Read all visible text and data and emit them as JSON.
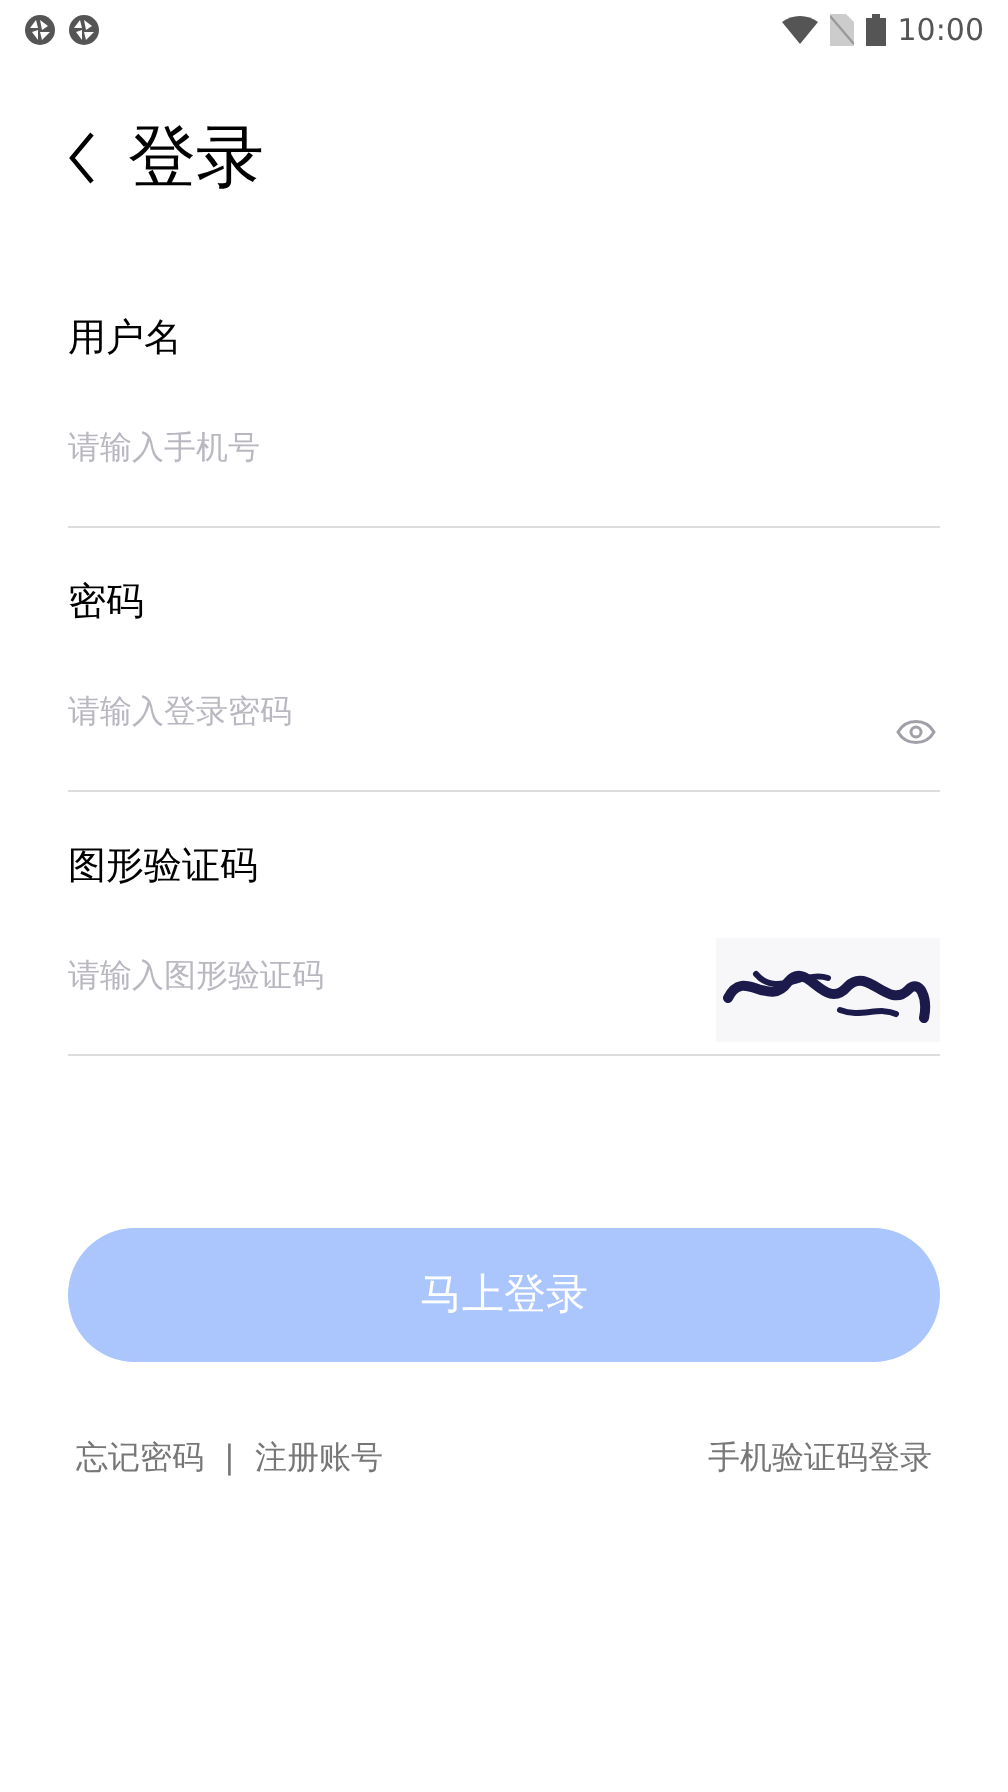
{
  "status_bar": {
    "time": "10:00"
  },
  "header": {
    "title": "登录"
  },
  "fields": [
    {
      "kind": "text",
      "label": "用户名",
      "placeholder": "请输入手机号"
    },
    {
      "kind": "password",
      "label": "密码",
      "placeholder": "请输入登录密码"
    },
    {
      "kind": "captcha",
      "label": "图形验证码",
      "placeholder": "请输入图形验证码"
    }
  ],
  "submit": {
    "label": "马上登录",
    "disabled": true
  },
  "links": {
    "left": [
      "忘记密码",
      "注册账号"
    ],
    "separator": "|",
    "right": "手机验证码登录"
  }
}
